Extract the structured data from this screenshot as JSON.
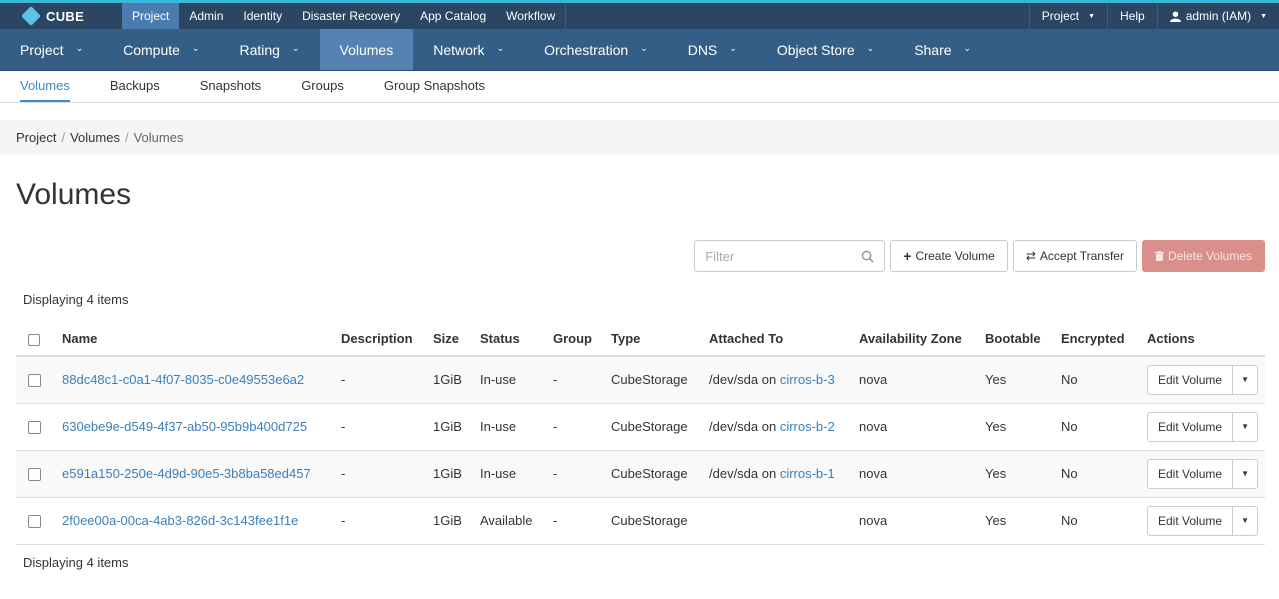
{
  "brand": {
    "name": "CUBE"
  },
  "top_menu": [
    {
      "label": "Project",
      "active": true
    },
    {
      "label": "Admin",
      "active": false
    },
    {
      "label": "Identity",
      "active": false
    },
    {
      "label": "Disaster Recovery",
      "active": false
    },
    {
      "label": "App Catalog",
      "active": false
    },
    {
      "label": "Workflow",
      "active": false
    }
  ],
  "top_right": {
    "project": "Project",
    "help": "Help",
    "user": "admin (IAM)"
  },
  "main_nav": [
    {
      "label": "Project",
      "has_dropdown": true,
      "active": false
    },
    {
      "label": "Compute",
      "has_dropdown": true,
      "active": false
    },
    {
      "label": "Rating",
      "has_dropdown": true,
      "active": false
    },
    {
      "label": "Volumes",
      "has_dropdown": false,
      "active": true
    },
    {
      "label": "Network",
      "has_dropdown": true,
      "active": false
    },
    {
      "label": "Orchestration",
      "has_dropdown": true,
      "active": false
    },
    {
      "label": "DNS",
      "has_dropdown": true,
      "active": false
    },
    {
      "label": "Object Store",
      "has_dropdown": true,
      "active": false
    },
    {
      "label": "Share",
      "has_dropdown": true,
      "active": false
    }
  ],
  "sub_nav": [
    {
      "label": "Volumes",
      "active": true
    },
    {
      "label": "Backups",
      "active": false
    },
    {
      "label": "Snapshots",
      "active": false
    },
    {
      "label": "Groups",
      "active": false
    },
    {
      "label": "Group Snapshots",
      "active": false
    }
  ],
  "breadcrumb": {
    "items": [
      "Project",
      "Volumes"
    ],
    "current": "Volumes",
    "separator": "/"
  },
  "page_title": "Volumes",
  "actions": {
    "filter_placeholder": "Filter",
    "create_label": "Create Volume",
    "accept_label": "Accept Transfer",
    "delete_label": "Delete Volumes"
  },
  "count_text": "Displaying 4 items",
  "table": {
    "headers": [
      "Name",
      "Description",
      "Size",
      "Status",
      "Group",
      "Type",
      "Attached To",
      "Availability Zone",
      "Bootable",
      "Encrypted",
      "Actions"
    ],
    "rows": [
      {
        "name": "88dc48c1-c0a1-4f07-8035-c0e49553e6a2",
        "description": "-",
        "size": "1GiB",
        "status": "In-use",
        "group": "-",
        "type": "CubeStorage",
        "attached_prefix": "/dev/sda on ",
        "attached_link": "cirros-b-3",
        "zone": "nova",
        "bootable": "Yes",
        "encrypted": "No",
        "action": "Edit Volume"
      },
      {
        "name": "630ebe9e-d549-4f37-ab50-95b9b400d725",
        "description": "-",
        "size": "1GiB",
        "status": "In-use",
        "group": "-",
        "type": "CubeStorage",
        "attached_prefix": "/dev/sda on ",
        "attached_link": "cirros-b-2",
        "zone": "nova",
        "bootable": "Yes",
        "encrypted": "No",
        "action": "Edit Volume"
      },
      {
        "name": "e591a150-250e-4d9d-90e5-3b8ba58ed457",
        "description": "-",
        "size": "1GiB",
        "status": "In-use",
        "group": "-",
        "type": "CubeStorage",
        "attached_prefix": "/dev/sda on ",
        "attached_link": "cirros-b-1",
        "zone": "nova",
        "bootable": "Yes",
        "encrypted": "No",
        "action": "Edit Volume"
      },
      {
        "name": "2f0ee00a-00ca-4ab3-826d-3c143fee1f1e",
        "description": "-",
        "size": "1GiB",
        "status": "Available",
        "group": "-",
        "type": "CubeStorage",
        "attached_prefix": "",
        "attached_link": "",
        "zone": "nova",
        "bootable": "Yes",
        "encrypted": "No",
        "action": "Edit Volume"
      }
    ]
  },
  "colors": {
    "top_bar": "#2a4662",
    "main_nav": "#355e86",
    "accent": "#3bb6d6",
    "link": "#3b7fba",
    "danger": "#d98f8a"
  }
}
